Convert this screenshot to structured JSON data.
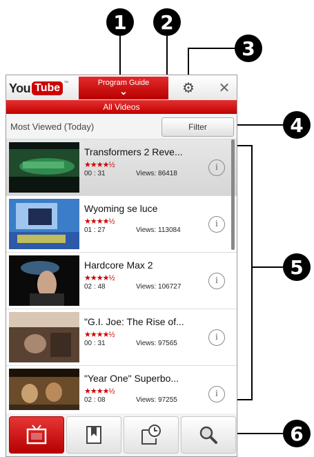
{
  "callouts": [
    "1",
    "2",
    "3",
    "4",
    "5",
    "6"
  ],
  "header": {
    "logo_you": "You",
    "logo_tube": "Tube",
    "logo_tm": "™",
    "program_guide": "Program Guide",
    "chevron": "⌄",
    "gear_icon": "⚙",
    "close_icon": "✕"
  },
  "category": "All Videos",
  "filter_bar": {
    "sort_label": "Most Viewed (Today)",
    "filter_button": "Filter"
  },
  "videos": [
    {
      "title": "Transformers 2 Reve...",
      "rating": "★★★★½",
      "duration": "00 : 31",
      "views": "Views: 86418"
    },
    {
      "title": "Wyoming se luce",
      "rating": "★★★★½",
      "duration": "01 : 27",
      "views": "Views: 113084"
    },
    {
      "title": "Hardcore Max 2",
      "rating": "★★★★½",
      "duration": "02 : 48",
      "views": "Views: 106727"
    },
    {
      "title": "\"G.I. Joe: The Rise of...",
      "rating": "★★★★½",
      "duration": "00 : 31",
      "views": "Views: 97565"
    },
    {
      "title": "\"Year One\" Superbo...",
      "rating": "★★★★½",
      "duration": "02 : 08",
      "views": "Views: 97255"
    }
  ],
  "info_glyph": "i",
  "tabs": [
    {
      "name": "programs-tab",
      "icon": "tv-icon"
    },
    {
      "name": "bookmarks-tab",
      "icon": "bookmark-icon"
    },
    {
      "name": "history-tab",
      "icon": "history-icon"
    },
    {
      "name": "search-tab",
      "icon": "search-icon"
    }
  ],
  "colors": {
    "accent": "#c00000",
    "star": "#cc0000"
  }
}
